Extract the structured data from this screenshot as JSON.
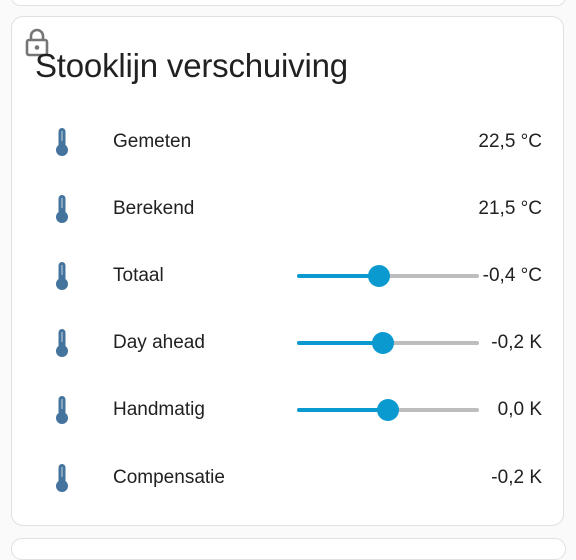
{
  "card": {
    "title": "Stooklijn verschuiving"
  },
  "colors": {
    "icon": "#44739e",
    "accent": "#0b9ad0",
    "track": "#bdbdbd"
  },
  "rows": [
    {
      "label": "Gemeten",
      "value": "22,5 °C",
      "icon": "thermometer-icon"
    },
    {
      "label": "Berekend",
      "value": "21,5 °C",
      "icon": "thermometer-icon"
    },
    {
      "label": "Totaal",
      "value": "-0,4 °C",
      "icon": "thermometer-icon",
      "slider_level": 0.45
    },
    {
      "label": "Day ahead",
      "value": "-0,2 K",
      "icon": "thermometer-icon",
      "slider_level": 0.47
    },
    {
      "label": "Handmatig",
      "value": "0,0 K",
      "icon": "thermometer-icon",
      "slider_level": 0.5
    },
    {
      "label": "Compensatie",
      "value": "-0,2 K",
      "icon": "thermometer-icon"
    }
  ]
}
